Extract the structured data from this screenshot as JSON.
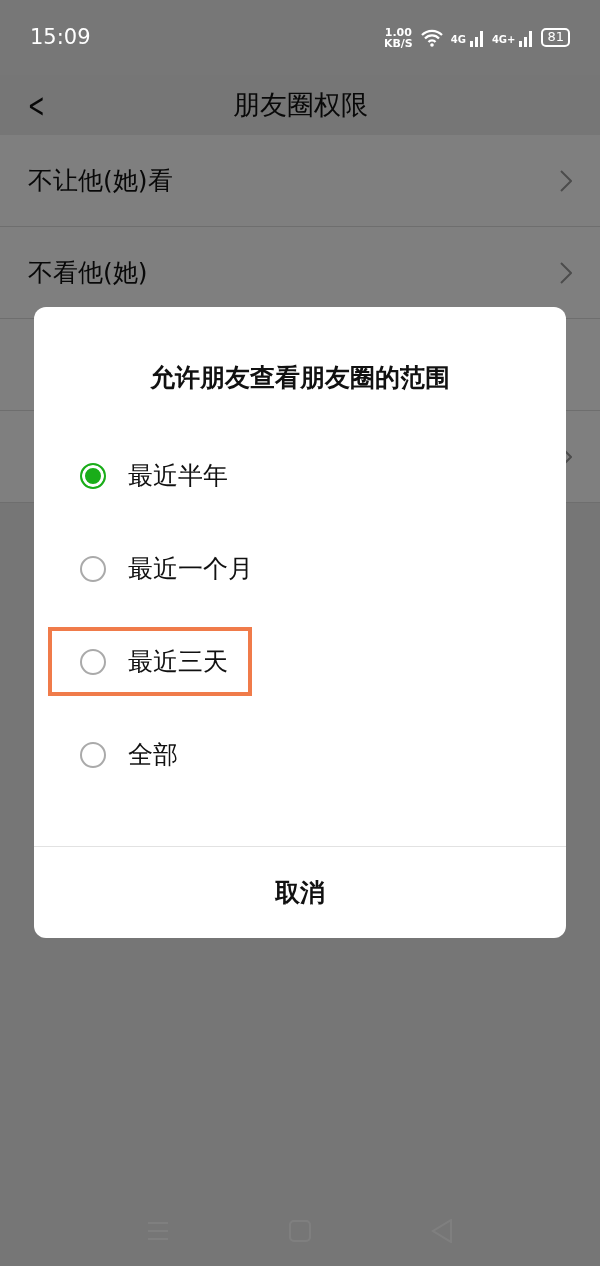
{
  "status_bar": {
    "time": "15:09",
    "speed": "1.00",
    "speed_unit": "KB/S",
    "sim_1": "4G",
    "sim_2": "4G+",
    "battery": "81"
  },
  "header": {
    "back": "<",
    "title": "朋友圈权限"
  },
  "rows": [
    {
      "label": "不让他(她)看",
      "kind": "chevron"
    },
    {
      "label": "不看他(她)",
      "kind": "chevron"
    },
    {
      "kind": "blank"
    },
    {
      "kind": "chevron"
    }
  ],
  "dialog": {
    "title": "允许朋友查看朋友圈的范围",
    "options": [
      {
        "label": "最近半年",
        "selected": true,
        "highlighted": false
      },
      {
        "label": "最近一个月",
        "selected": false,
        "highlighted": false
      },
      {
        "label": "最近三天",
        "selected": false,
        "highlighted": true
      },
      {
        "label": "全部",
        "selected": false,
        "highlighted": false
      }
    ],
    "cancel": "取消"
  }
}
